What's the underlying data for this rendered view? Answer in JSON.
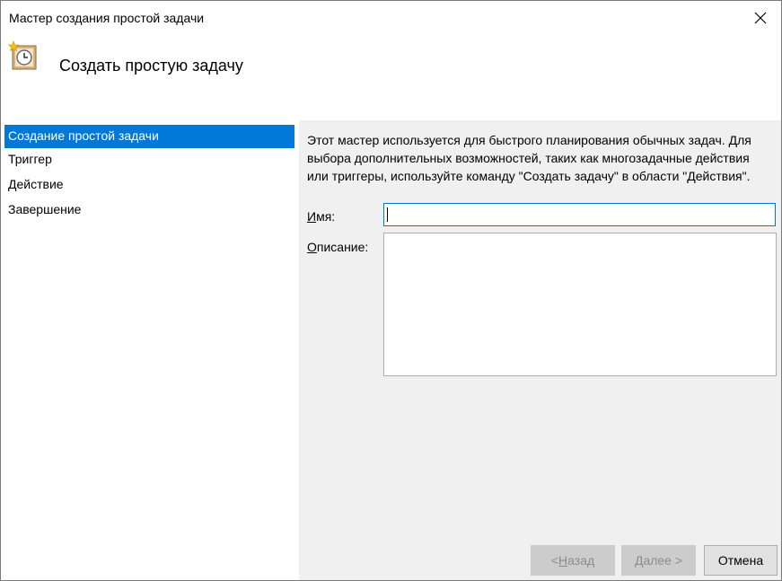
{
  "window": {
    "title": "Мастер создания простой задачи"
  },
  "header": {
    "title": "Создать простую задачу",
    "icon": "scheduled-task-clock-icon"
  },
  "steps": [
    {
      "label": "Создание простой задачи",
      "active": true
    },
    {
      "label": "Триггер",
      "active": false
    },
    {
      "label": "Действие",
      "active": false
    },
    {
      "label": "Завершение",
      "active": false
    }
  ],
  "content": {
    "description": "Этот мастер используется для быстрого планирования обычных задач. Для выбора дополнительных возможностей, таких как многозадачные действия или триггеры, используйте команду \"Создать задачу\" в области \"Действия\".",
    "name_label_accel": "И",
    "name_label_rest": "мя:",
    "name_value": "",
    "desc_label_accel": "О",
    "desc_label_rest": "писание:",
    "desc_value": ""
  },
  "buttons": {
    "back_prefix": "< ",
    "back_accel": "Н",
    "back_rest": "азад",
    "next_accel": "Д",
    "next_rest": "алее >",
    "cancel": "Отмена"
  },
  "colors": {
    "selection": "#0078d7",
    "panel": "#f0f0f0"
  }
}
